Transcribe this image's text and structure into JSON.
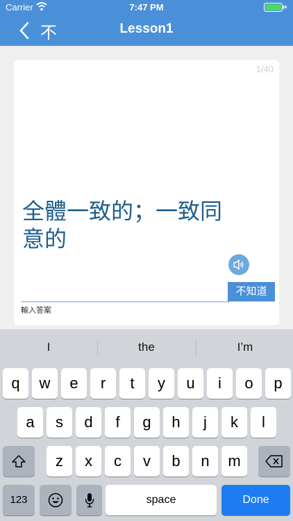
{
  "status_bar": {
    "carrier": "Carrier",
    "time": "7:47 PM",
    "wifi_icon": "wifi-icon",
    "battery_icon": "battery-icon",
    "battery_color": "#4cd964"
  },
  "navbar": {
    "back_icon": "chevron-left-icon",
    "dont_know_label": "不",
    "title": "Lesson1",
    "color": "#4a90d9"
  },
  "card": {
    "counter": "1/40",
    "question_line1": "全體一致的；一致同",
    "question_line2": "意的",
    "speaker_icon": "speaker-icon",
    "answer_value": "",
    "answer_placeholder": "輸入答案",
    "dont_know_button": "不知道"
  },
  "keyboard": {
    "suggestions": [
      "I",
      "the",
      "I’m"
    ],
    "row1": [
      "q",
      "w",
      "e",
      "r",
      "t",
      "y",
      "u",
      "i",
      "o",
      "p"
    ],
    "row2": [
      "a",
      "s",
      "d",
      "f",
      "g",
      "h",
      "j",
      "k",
      "l"
    ],
    "row3": [
      "z",
      "x",
      "c",
      "v",
      "b",
      "n",
      "m"
    ],
    "shift_icon": "shift-icon",
    "delete_icon": "delete-icon",
    "numbers_label": "123",
    "emoji_icon": "emoji-icon",
    "mic_icon": "microphone-icon",
    "space_label": "space",
    "done_label": "Done"
  }
}
